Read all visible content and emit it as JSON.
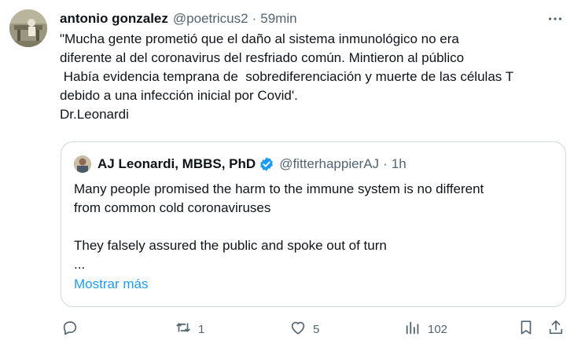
{
  "tweet": {
    "author_name": "antonio gonzalez",
    "author_handle": "@poetricus2",
    "separator": "·",
    "time": "59min",
    "text": "\"Mucha gente prometió que el daño al sistema inmunológico no era\ndiferente al del coronavirus del resfriado común. Mintieron al público\n Había evidencia temprana de  sobrediferenciación y muerte de las células T\ndebido a una infección inicial por Covid'.\nDr.Leonardi"
  },
  "quote": {
    "author_name": "AJ Leonardi, MBBS, PhD",
    "author_handle": "@fitterhappierAJ",
    "separator": "·",
    "time": "1h",
    "text": "Many people promised the harm to the immune system is no different\nfrom common cold coronaviruses\n\nThey falsely assured the public and spoke out of turn\n...",
    "show_more": "Mostrar más"
  },
  "actions": {
    "reply_count": "",
    "retweet_count": "1",
    "like_count": "5",
    "views_count": "102"
  },
  "icons": {
    "more": "more-dots-icon",
    "verified": "verified-badge-icon",
    "reply": "reply-icon",
    "retweet": "retweet-icon",
    "like": "heart-icon",
    "views": "views-icon",
    "bookmark": "bookmark-icon",
    "share": "share-icon"
  },
  "colors": {
    "text": "#0f1419",
    "secondary": "#536471",
    "link": "#1d9bf0",
    "border": "#cfd9de"
  }
}
